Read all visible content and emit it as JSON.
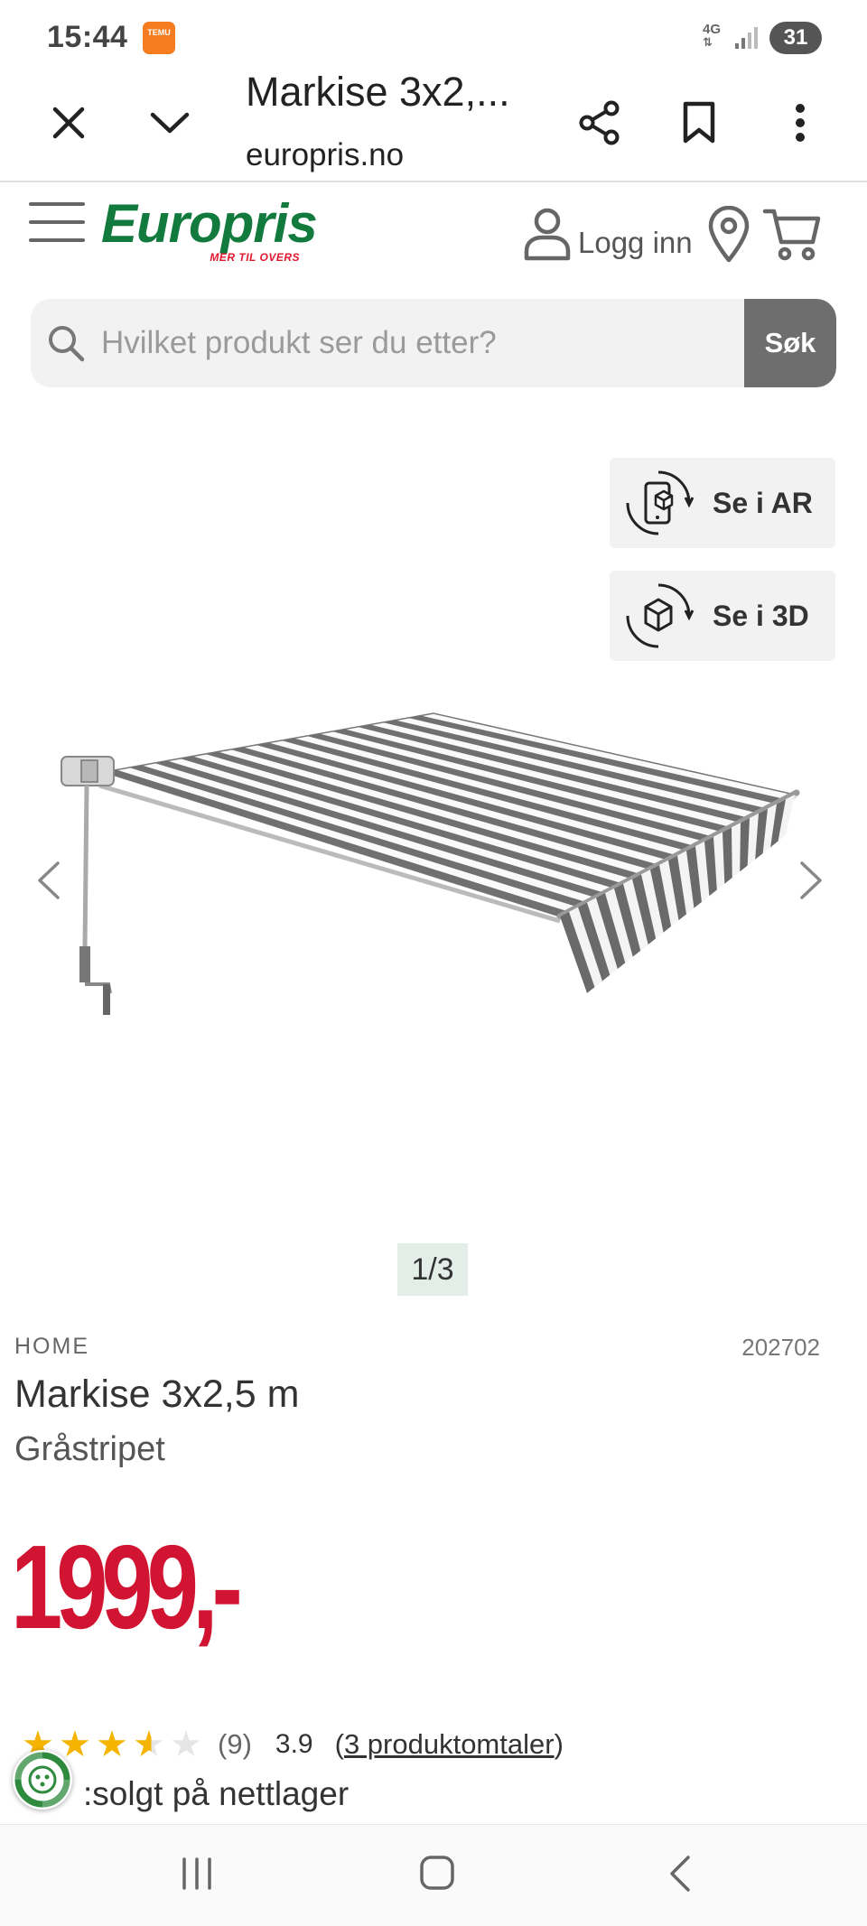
{
  "status_bar": {
    "time": "15:44",
    "app_badge": "TEMU",
    "network": "4G",
    "battery": "31"
  },
  "browser": {
    "tab_title": "Markise 3x2,...",
    "url": "europris.no"
  },
  "header": {
    "logo_text": "Europris",
    "logo_tagline": "MER TIL OVERS",
    "login_label": "Logg inn"
  },
  "search": {
    "placeholder": "Hvilket produkt ser du etter?",
    "button_label": "Søk"
  },
  "view_options": {
    "ar_label": "Se i AR",
    "threed_label": "Se i 3D"
  },
  "gallery": {
    "counter": "1/3"
  },
  "product": {
    "brand": "HOME",
    "sku": "202702",
    "title": "Markise 3x2,5 m",
    "variant": "Gråstripet",
    "price": "1999,-",
    "rating_count": "(9)",
    "rating_value": "3.9",
    "reviews_link": "3 produktomtaler",
    "stock_text": ":solgt på nettlager",
    "rating_stars": 3.5
  },
  "colors": {
    "brand_green": "#117a3c",
    "price_red": "#d01431",
    "star_yellow": "#f5b400"
  }
}
